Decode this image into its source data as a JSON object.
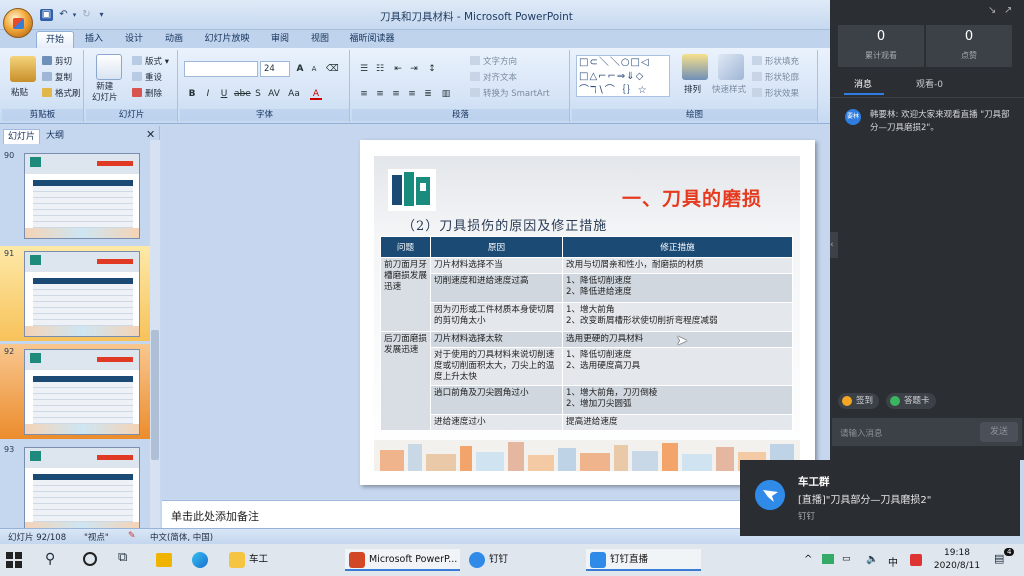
{
  "window": {
    "title": "刀具和刀具材料 - Microsoft PowerPoint"
  },
  "ribbon": {
    "tabs": [
      "开始",
      "插入",
      "设计",
      "动画",
      "幻灯片放映",
      "审阅",
      "视图",
      "福昕阅读器"
    ],
    "clipboard": {
      "paste": "粘贴",
      "cut": "剪切",
      "copy": "复制",
      "format_painter": "格式刷",
      "group": "剪贴板"
    },
    "slides": {
      "new_slide": "新建\n幻灯片",
      "layout": "版式",
      "reset": "重设",
      "delete": "删除",
      "group": "幻灯片"
    },
    "font": {
      "size": "24",
      "group": "字体"
    },
    "paragraph": {
      "text_direction": "文字方向",
      "align_text": "对齐文本",
      "smartart": "转换为 SmartArt",
      "group": "段落"
    },
    "drawing": {
      "arrange": "排列",
      "quick_styles": "快速样式",
      "shape_fill": "形状填充",
      "shape_outline": "形状轮廓",
      "shape_effects": "形状效果",
      "group": "绘图"
    }
  },
  "slide_panel": {
    "tabs": [
      "幻灯片",
      "大纲"
    ],
    "thumbnails": [
      {
        "num": "90",
        "state": "normal"
      },
      {
        "num": "91",
        "state": "hover"
      },
      {
        "num": "92",
        "state": "current"
      },
      {
        "num": "93",
        "state": "normal"
      }
    ]
  },
  "slide": {
    "title": "一、刀具的磨损",
    "subtitle": "（2）刀具损伤的原因及修正措施",
    "table": {
      "headers": [
        "问题",
        "原因",
        "修正措施"
      ],
      "groups": [
        {
          "problem": "前刀面月牙槽磨损发展迅速",
          "rows": [
            {
              "cause": "刀片材料选择不当",
              "fix": "改用与切屑亲和性小，耐磨损的材质"
            },
            {
              "cause": "切削速度和进给速度过高",
              "fix": "1、降低切削速度\n2、降低进给速度"
            },
            {
              "cause": "因为刃形或工件材质本身使切屑的剪切角太小",
              "fix": "1、增大前角\n2、改变断屑槽形状使切削折弯程度减弱"
            }
          ]
        },
        {
          "problem": "后刀面磨损发展迅速",
          "rows": [
            {
              "cause": "刀片材料选择太软",
              "fix": "选用更硬的刀具材料"
            },
            {
              "cause": "对于使用的刀具材料来说切削速度或切削面积太大，刀尖上的温度上升太快",
              "fix": "1、降低切削速度\n2、选用硬度高刀具"
            },
            {
              "cause": "逍口前角及刀尖圆角过小",
              "fix": "1、增大前角，刀刃倒棱\n2、增加刀尖圆弧"
            },
            {
              "cause": "进给速度过小",
              "fix": "提高进给速度"
            }
          ]
        }
      ]
    }
  },
  "notes": {
    "placeholder": "单击此处添加备注"
  },
  "status": {
    "slide_info": "幻灯片 92/108",
    "theme": "\"视点\"",
    "language": "中文(简体, 中国)"
  },
  "live": {
    "stats": [
      {
        "value": "0",
        "label": "累计观看"
      },
      {
        "value": "0",
        "label": "点赞"
      }
    ],
    "tabs": [
      "消息",
      "观看-0"
    ],
    "message": {
      "avatar": "要林",
      "text": "韩要林: 欢迎大家来观看直播 \"刀具部分—刀具磨损2\"。"
    },
    "buttons": [
      "签到",
      "答题卡"
    ],
    "input_placeholder": "请输入消息",
    "send": "发送"
  },
  "notification": {
    "title": "车工群",
    "body": "[直播]\"刀具部分—刀具磨损2\"",
    "app": "钉钉"
  },
  "taskbar": {
    "items": [
      "车工",
      "Microsoft PowerP...",
      "钉钉",
      "钉钉直播"
    ],
    "time": "19:18",
    "date": "2020/8/11",
    "ime": "中",
    "notifications": "4"
  }
}
